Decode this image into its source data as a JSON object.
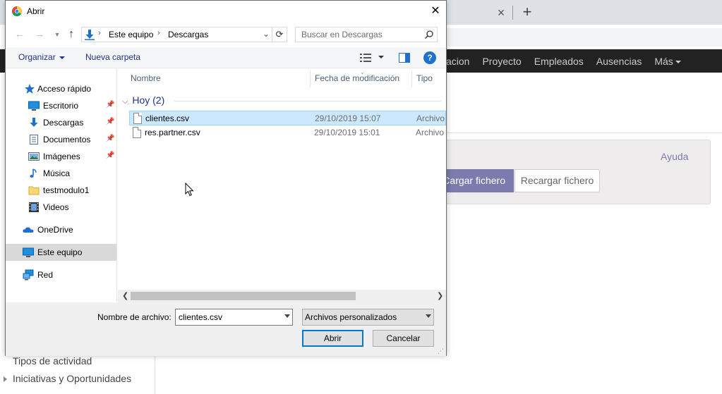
{
  "browser": {
    "tab_close": "×",
    "new_tab": "+"
  },
  "app_nav": {
    "items": [
      "acion",
      "Proyecto",
      "Empleados",
      "Ausencias"
    ],
    "more_label": "Más"
  },
  "import_panel": {
    "help_label": "Ayuda",
    "load_file_label": "Cargar fichero",
    "reload_file_label": "Recargar fichero"
  },
  "app_sidebar": {
    "items": [
      "Tipos de actividad",
      "Iniciativas y Oportunidades"
    ]
  },
  "dialog": {
    "title": "Abrir",
    "close": "✕",
    "address": {
      "segments": [
        "Este equipo",
        "Descargas"
      ],
      "separator": "›"
    },
    "search": {
      "placeholder": "Buscar en Descargas"
    },
    "command_bar": {
      "organize_label": "Organizar",
      "new_folder_label": "Nueva carpeta",
      "help_label": "?"
    },
    "nav_pane": {
      "quick_access": "Acceso rápido",
      "items": [
        {
          "label": "Escritorio",
          "icon": "desktop-icon",
          "pinned": true
        },
        {
          "label": "Descargas",
          "icon": "download-icon",
          "pinned": true
        },
        {
          "label": "Documentos",
          "icon": "documents-icon",
          "pinned": true
        },
        {
          "label": "Imágenes",
          "icon": "pictures-icon",
          "pinned": true
        },
        {
          "label": "Música",
          "icon": "music-icon",
          "pinned": false
        },
        {
          "label": "testmodulo1",
          "icon": "folder-icon",
          "pinned": false
        },
        {
          "label": "Videos",
          "icon": "videos-icon",
          "pinned": false
        }
      ],
      "onedrive": "OneDrive",
      "this_pc": "Este equipo",
      "network": "Red"
    },
    "columns": {
      "name": "Nombre",
      "modified": "Fecha de modificación",
      "type": "Tipo"
    },
    "group": {
      "label": "Hoy (2)"
    },
    "files": [
      {
        "name": "clientes.csv",
        "modified": "29/10/2019 15:07",
        "type": "Archivo",
        "selected": true
      },
      {
        "name": "res.partner.csv",
        "modified": "29/10/2019 15:01",
        "type": "Archivo",
        "selected": false
      }
    ],
    "footer": {
      "filename_label": "Nombre de archivo:",
      "filename_value": "clientes.csv",
      "filter_value": "Archivos personalizados",
      "open_label": "Abrir",
      "cancel_label": "Cancelar"
    },
    "colors": {
      "accent": "#0078d7",
      "selection": "#cce8ff",
      "link_blue": "#1e3287"
    }
  }
}
